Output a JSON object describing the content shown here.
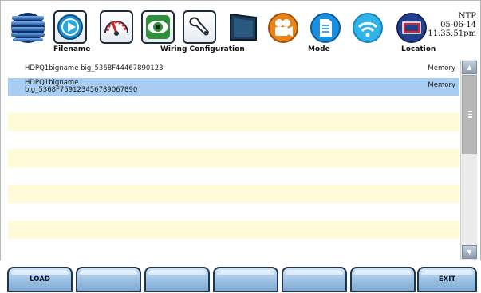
{
  "toolbar": {
    "labels": {
      "filename": "Filename",
      "wiring": "Wiring Configuration",
      "mode": "Mode",
      "location": "Location"
    },
    "clock": {
      "sync": "NTP",
      "date": "05-06-14",
      "time": "11:35:51pm"
    },
    "icons": [
      "menu-icon",
      "play-icon",
      "gauge-icon",
      "eye-icon",
      "wrench-icon",
      "monitor-icon",
      "camera-icon",
      "document-icon",
      "wifi-icon",
      "location-screen-icon"
    ],
    "colors": {
      "orange": "#e8841a",
      "blue": "#1a8fe0",
      "teal": "#2a8fa0",
      "navy": "#23408e",
      "red": "#d8232a"
    }
  },
  "files": [
    {
      "name_line1": "HDPQ1bigname big_5368F44467890123",
      "name_line2": "",
      "location": "Memory",
      "selected": false
    },
    {
      "name_line1": "HDPQ1bigname",
      "name_line2": "big_5368F759123456789067890",
      "location": "Memory",
      "selected": true
    }
  ],
  "buttons": {
    "load": "LOAD",
    "b2": "",
    "b3": "",
    "b4": "",
    "b5": "",
    "b6": "",
    "exit": "EXIT"
  },
  "colors": {
    "row_selected": "#a7cdf2",
    "row_alt": "#fffbd8",
    "button_top": "#cfe3f6",
    "button_bottom": "#7faad4"
  }
}
